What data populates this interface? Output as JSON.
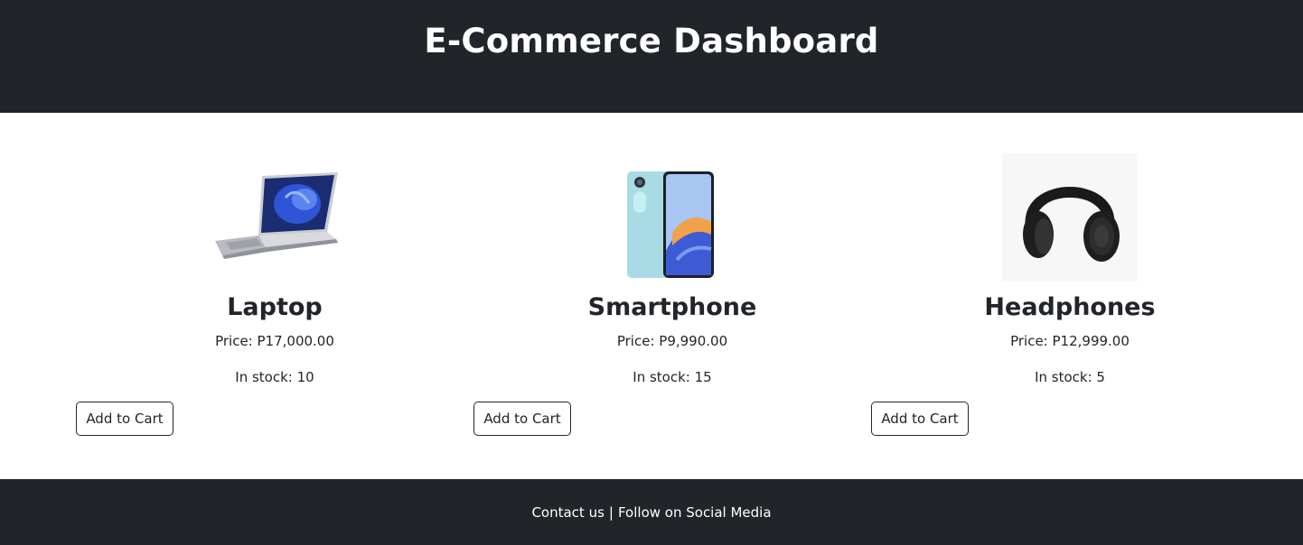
{
  "header": {
    "title": "E-Commerce Dashboard"
  },
  "products": [
    {
      "name": "Laptop",
      "price": "Price: P17,000.00",
      "stock": "In stock: 10",
      "button": "Add to Cart",
      "image_icon": "laptop-image"
    },
    {
      "name": "Smartphone",
      "price": "Price: P9,990.00",
      "stock": "In stock: 15",
      "button": "Add to Cart",
      "image_icon": "smartphone-image"
    },
    {
      "name": "Headphones",
      "price": "Price: P12,999.00",
      "stock": "In stock: 5",
      "button": "Add to Cart",
      "image_icon": "headphones-image"
    }
  ],
  "footer": {
    "contact": "Contact us",
    "separator": "|",
    "social": "Follow on Social Media"
  },
  "colors": {
    "dark": "#212529",
    "light": "#ffffff"
  }
}
